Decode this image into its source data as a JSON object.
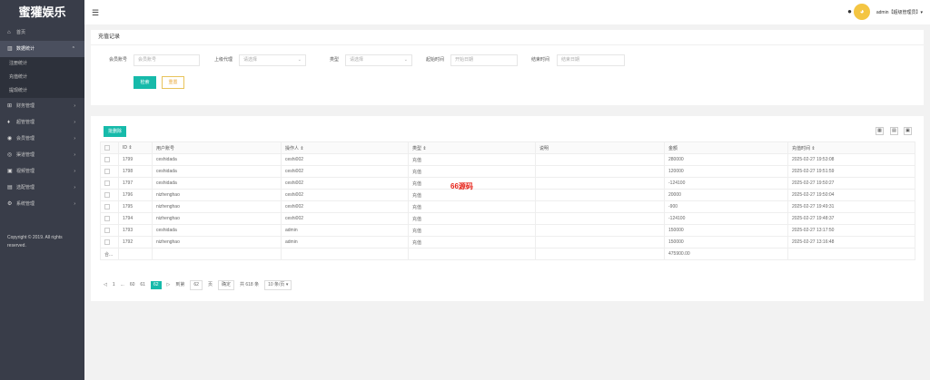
{
  "app": {
    "title": "蜜獾娱乐"
  },
  "sidebar": {
    "items": [
      {
        "icon": "⌂",
        "label": "首页"
      },
      {
        "icon": "▥",
        "label": "数据统计",
        "open": true
      },
      {
        "icon": "⊞",
        "label": "财务管理"
      },
      {
        "icon": "♦",
        "label": "超管管理"
      },
      {
        "icon": "◉",
        "label": "会员管理"
      },
      {
        "icon": "◎",
        "label": "渠道管理"
      },
      {
        "icon": "▣",
        "label": "视频管理"
      },
      {
        "icon": "▤",
        "label": "选配管理"
      },
      {
        "icon": "⚙",
        "label": "系统管理"
      }
    ],
    "sub_items": [
      "注册统计",
      "充值统计",
      "提现统计"
    ],
    "copyright": "Copyright © 2019. All rights reserved."
  },
  "header": {
    "user": "admin【超级管理员】▾"
  },
  "filter": {
    "title": "充值记录",
    "member_label": "会员账号",
    "member_placeholder": "会员账号",
    "agent_label": "上级代理",
    "agent_placeholder": "请选择",
    "type_label": "类型",
    "type_placeholder": "请选择",
    "start_label": "起始时间",
    "start_placeholder": "开始日期",
    "end_label": "结束时间",
    "end_placeholder": "结束日期",
    "search_btn": "检索",
    "reset_btn": "重置"
  },
  "table": {
    "delete_btn": "批删除",
    "headers": [
      "ID ⇕",
      "用户账号",
      "操作人 ⇕",
      "类型 ⇕",
      "说明",
      "金额",
      "充值时间 ⇕"
    ],
    "rows": [
      {
        "id": "1799",
        "user": "ceshidada",
        "operator": "ceshi002",
        "type": "充值",
        "note": "",
        "amount": "280000",
        "time": "2025-02-27 19:53:08"
      },
      {
        "id": "1798",
        "user": "ceshidada",
        "operator": "ceshi002",
        "type": "充值",
        "note": "",
        "amount": "120000",
        "time": "2025-02-27 19:51:59"
      },
      {
        "id": "1797",
        "user": "ceshidada",
        "operator": "ceshi002",
        "type": "充值",
        "note": "",
        "amount": "-124100",
        "time": "2025-02-27 19:50:27"
      },
      {
        "id": "1796",
        "user": "nizhenghao",
        "operator": "ceshi002",
        "type": "充值",
        "note": "",
        "amount": "20000",
        "time": "2025-02-27 19:50:04"
      },
      {
        "id": "1795",
        "user": "nizhenghao",
        "operator": "ceshi002",
        "type": "充值",
        "note": "",
        "amount": "-900",
        "time": "2025-02-27 19:49:31"
      },
      {
        "id": "1794",
        "user": "nizhenghao",
        "operator": "ceshi002",
        "type": "充值",
        "note": "",
        "amount": "-124100",
        "time": "2025-02-27 19:48:37"
      },
      {
        "id": "1793",
        "user": "ceshidada",
        "operator": "admin",
        "type": "充值",
        "note": "",
        "amount": "150000",
        "time": "2025-02-27 13:17:50"
      },
      {
        "id": "1792",
        "user": "nizhenghao",
        "operator": "admin",
        "type": "充值",
        "note": "",
        "amount": "150000",
        "time": "2025-02-27 13:16:48"
      }
    ],
    "total_label": "合...",
    "total_amount": "475900.00"
  },
  "pager": {
    "first": "1",
    "dots": "...",
    "p1": "60",
    "p2": "61",
    "current": "62",
    "goto": "到第",
    "input": "62",
    "page": "页",
    "confirm": "确定",
    "total": "共 618 条",
    "size": "10 条/页 ▾"
  },
  "watermark": "66源码"
}
